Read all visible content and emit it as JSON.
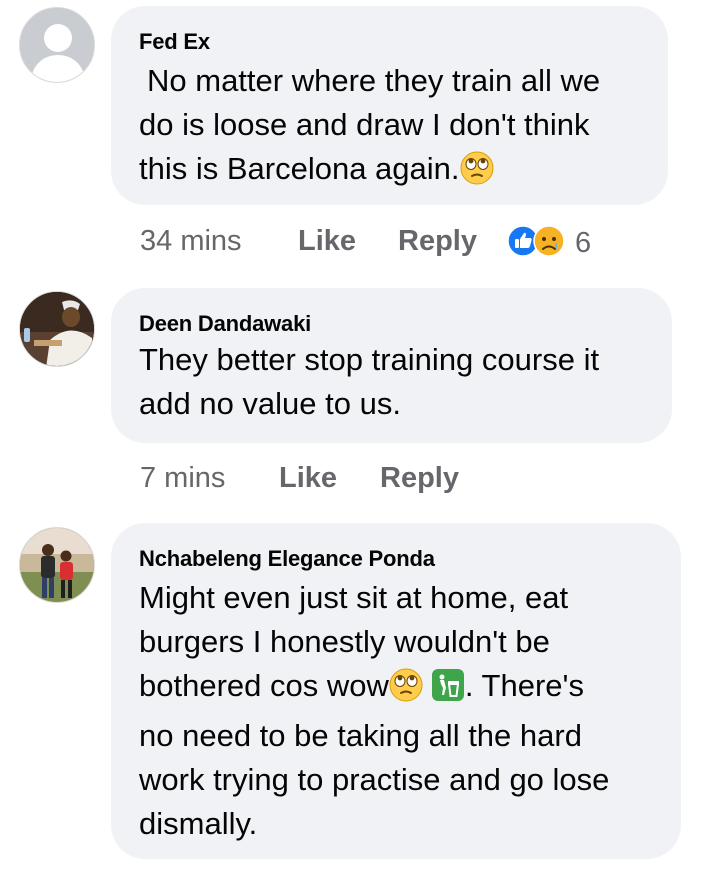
{
  "comments": [
    {
      "author": "Fed Ex",
      "text_lines": [
        "No matter where they train all we",
        "do is loose and draw I don't think",
        "this is Barcelona again."
      ],
      "time": "34 mins",
      "like_label": "Like",
      "reply_label": "Reply",
      "reaction_count": "6",
      "reaction_icons": [
        "like-icon",
        "sad-face-icon"
      ],
      "inline_emoji": [
        "eye-roll-emoji"
      ]
    },
    {
      "author": "Deen Dandawaki",
      "text_lines": [
        "They better stop training course it",
        "add no value to us."
      ],
      "time": "7 mins",
      "like_label": "Like",
      "reply_label": "Reply"
    },
    {
      "author": "Nchabeleng Elegance Ponda",
      "text_lines": [
        "Might even just sit at home, eat",
        "burgers I honestly wouldn't be",
        "bothered cos wow",
        ". There's",
        "no need to be taking all the hard",
        "work trying to practise and go lose",
        "dismally."
      ],
      "inline_emoji": [
        "eye-roll-emoji",
        "litter-bin-emoji"
      ]
    }
  ],
  "colors": {
    "bubble": "#f0f2f5",
    "meta_text": "#65676b",
    "like_blue": "#1877f2"
  }
}
